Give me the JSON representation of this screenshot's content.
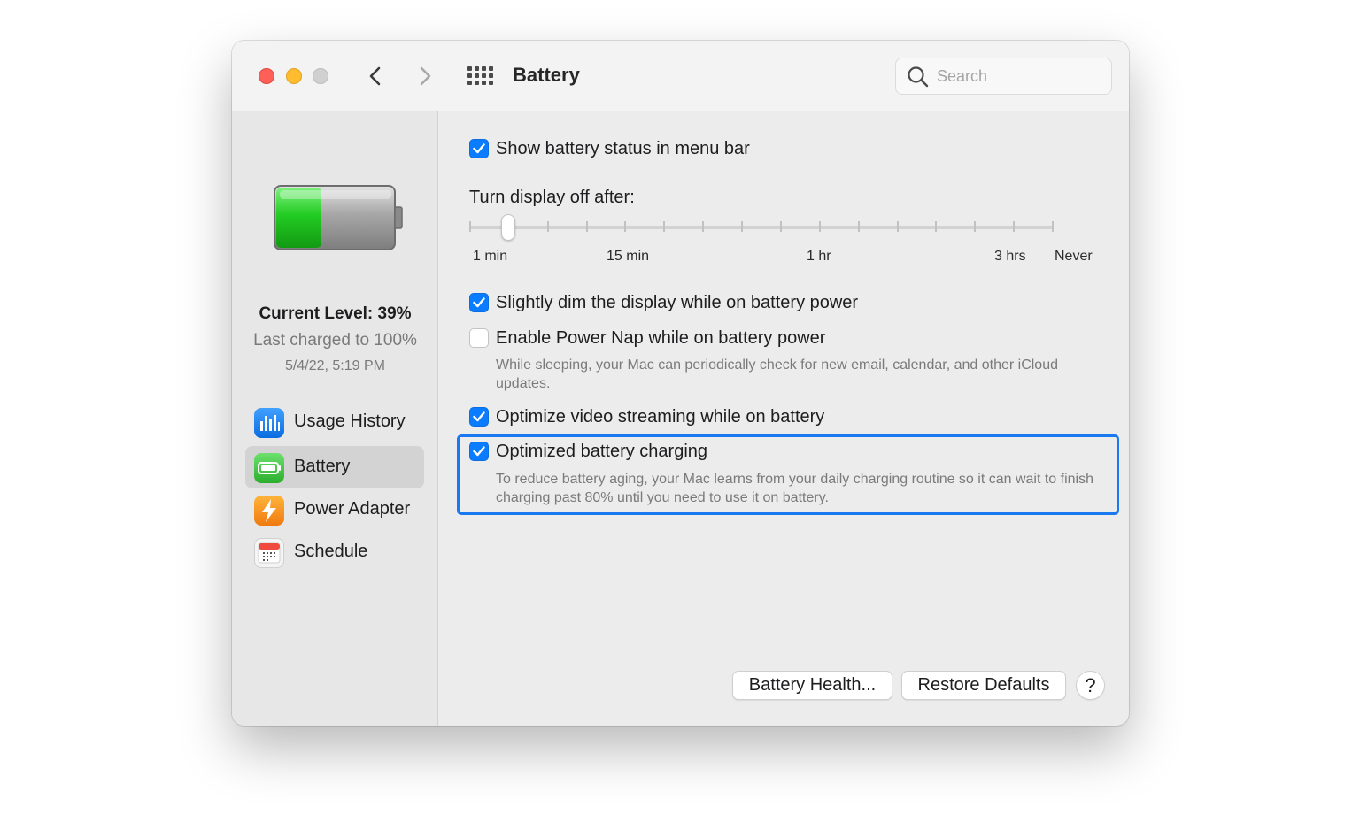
{
  "window": {
    "title": "Battery",
    "search_placeholder": "Search"
  },
  "sidebar": {
    "current_level": "Current Level: 39%",
    "battery_level_fraction": 0.39,
    "last_charged": "Last charged to 100%",
    "charge_date": "5/4/22, 5:19 PM",
    "items": [
      {
        "label": "Usage History",
        "icon": "usage-history-icon",
        "selected": false
      },
      {
        "label": "Battery",
        "icon": "battery-icon",
        "selected": true
      },
      {
        "label": "Power Adapter",
        "icon": "power-adapter-icon",
        "selected": false
      },
      {
        "label": "Schedule",
        "icon": "schedule-icon",
        "selected": false
      }
    ]
  },
  "main": {
    "show_status": {
      "label": "Show battery status in menu bar",
      "checked": true
    },
    "display_off": {
      "label": "Turn display off after:",
      "tick_labels": [
        "1 min",
        "15 min",
        "1 hr",
        "3 hrs",
        "Never"
      ],
      "tick_count": 16,
      "selected_step": 1
    },
    "dim_display": {
      "label": "Slightly dim the display while on battery power",
      "checked": true
    },
    "power_nap": {
      "label": "Enable Power Nap while on battery power",
      "checked": false,
      "description": "While sleeping, your Mac can periodically check for new email, calendar, and other iCloud updates."
    },
    "video_streaming": {
      "label": "Optimize video streaming while on battery",
      "checked": true
    },
    "optimized_charging": {
      "label": "Optimized battery charging",
      "checked": true,
      "description": "To reduce battery aging, your Mac learns from your daily charging routine so it can wait to finish charging past 80% until you need to use it on battery."
    }
  },
  "buttons": {
    "battery_health": "Battery Health...",
    "restore_defaults": "Restore Defaults",
    "help": "?"
  },
  "colors": {
    "accent": "#0a7cff",
    "battery_green": "#2bd12b",
    "close": "#fe5f57",
    "minimize": "#febc2e"
  }
}
